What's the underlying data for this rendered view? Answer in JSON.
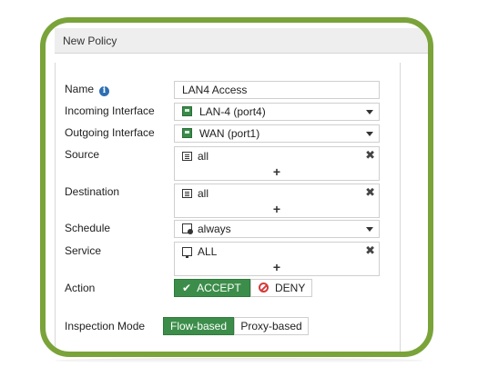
{
  "window": {
    "title": "New Policy"
  },
  "form": {
    "name": {
      "label": "Name",
      "value": "LAN4 Access"
    },
    "incoming": {
      "label": "Incoming Interface",
      "value": "LAN-4 (port4)"
    },
    "outgoing": {
      "label": "Outgoing Interface",
      "value": "WAN (port1)"
    },
    "source": {
      "label": "Source",
      "entry": "all",
      "add": "+",
      "remove": "✖"
    },
    "destination": {
      "label": "Destination",
      "entry": "all",
      "add": "+",
      "remove": "✖"
    },
    "schedule": {
      "label": "Schedule",
      "value": "always"
    },
    "service": {
      "label": "Service",
      "entry": "ALL",
      "add": "+",
      "remove": "✖"
    },
    "action": {
      "label": "Action",
      "accept": "ACCEPT",
      "deny": "DENY",
      "selected": "ACCEPT"
    },
    "inspection": {
      "label": "Inspection Mode",
      "flow": "Flow-based",
      "proxy": "Proxy-based",
      "selected": "Flow-based"
    }
  },
  "colors": {
    "frame": "#7aa33a",
    "accent": "#3c8d4a",
    "deny": "#d43b3b",
    "info": "#2d6fb5"
  },
  "icons": {
    "info": "info-icon",
    "interface": "interface-icon",
    "address": "address-icon",
    "schedule": "clock-icon",
    "service": "service-icon",
    "check": "check-icon",
    "deny": "ban-icon"
  }
}
